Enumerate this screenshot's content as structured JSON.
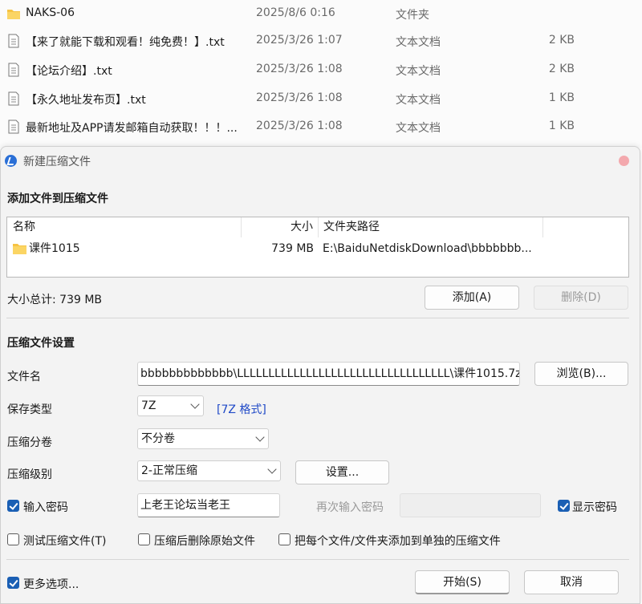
{
  "explorer": {
    "files": [
      {
        "name": "NAKS-06",
        "date": "2025/8/6 0:16",
        "type": "文件夹",
        "size": "",
        "icon": "folder-icon"
      },
      {
        "name": "【来了就能下载和观看！纯免费！】.txt",
        "date": "2025/3/26 1:07",
        "type": "文本文档",
        "size": "2 KB",
        "icon": "text-file-icon"
      },
      {
        "name": "【论坛介绍】.txt",
        "date": "2025/3/26 1:08",
        "type": "文本文档",
        "size": "2 KB",
        "icon": "text-file-icon"
      },
      {
        "name": "【永久地址发布页】.txt",
        "date": "2025/3/26 1:08",
        "type": "文本文档",
        "size": "1 KB",
        "icon": "text-file-icon"
      },
      {
        "name": "最新地址及APP请发邮箱自动获取！！！...",
        "date": "2025/3/26 1:08",
        "type": "文本文档",
        "size": "1 KB",
        "icon": "text-file-icon"
      }
    ]
  },
  "dialog": {
    "title": "新建压缩文件",
    "add_section_title": "添加文件到压缩文件",
    "table": {
      "headers": {
        "name": "名称",
        "size": "大小",
        "path": "文件夹路径"
      },
      "rows": [
        {
          "name": "课件1015",
          "size": "739 MB",
          "path": "E:\\BaiduNetdiskDownload\\bbbbbbb..."
        }
      ]
    },
    "total_size": "大小总计: 739 MB",
    "add_button": "添加(A)",
    "delete_button": "删除(D)",
    "settings_section_title": "压缩文件设置",
    "filename_label": "文件名",
    "filename_value": "bbbbbbbbbbbbb\\LLLLLLLLLLLLLLLLLLLLLLLLLLLLLLLLLL\\课件1015.7z",
    "browse_button": "浏览(B)...",
    "save_type_label": "保存类型",
    "save_type_value": "7Z",
    "format_link": "[7Z 格式]",
    "split_label": "压缩分卷",
    "split_value": "不分卷",
    "level_label": "压缩级别",
    "level_value": "2-正常压缩",
    "settings_button": "设置...",
    "password_label": "输入密码",
    "password_checked": true,
    "password_value": "上老王论坛当老王",
    "reenter_label": "再次输入密码",
    "show_password_label": "显示密码",
    "show_password_checked": true,
    "test_label": "测试压缩文件(T)",
    "test_checked": false,
    "delete_after_label": "压缩后删除原始文件",
    "delete_after_checked": false,
    "separate_label": "把每个文件/文件夹添加到单独的压缩文件",
    "separate_checked": false,
    "more_options_label": "更多选项...",
    "more_options_checked": true,
    "start_button": "开始(S)",
    "cancel_button": "取消"
  },
  "colors": {
    "accent": "#1a5fb4",
    "link": "#1f49c7",
    "folder": "#f6c343"
  }
}
